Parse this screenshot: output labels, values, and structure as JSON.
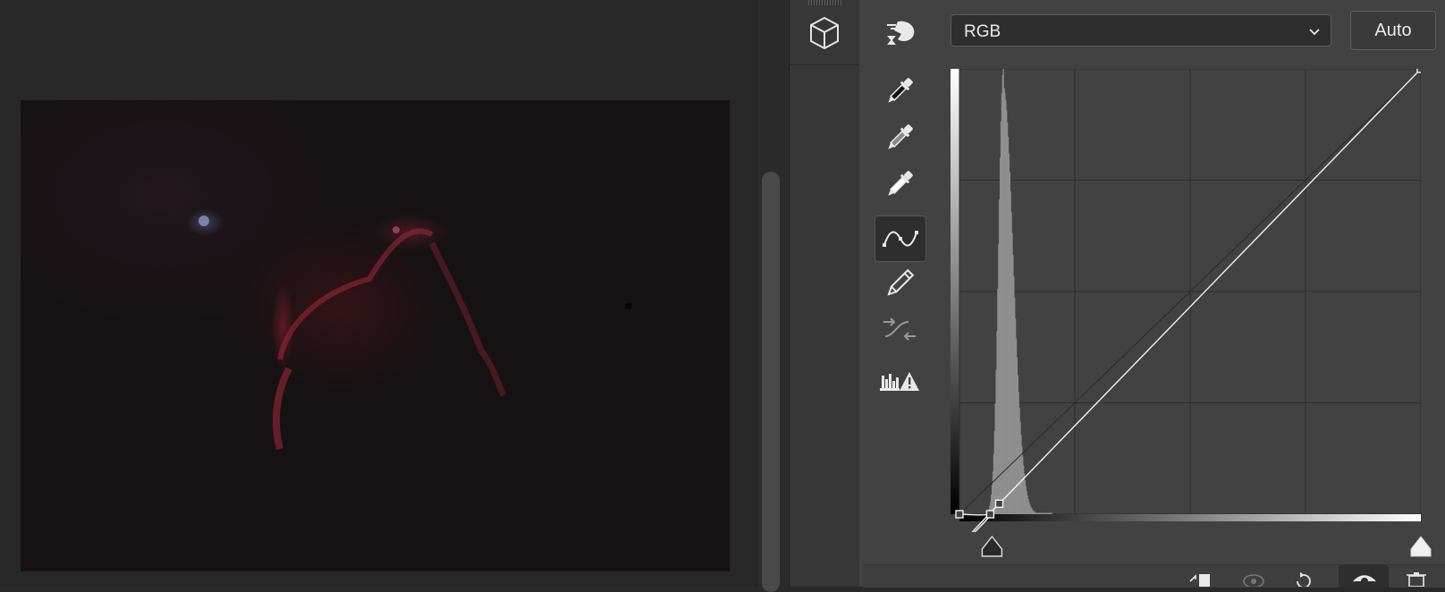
{
  "canvas": {
    "photo_name": "astro-photo"
  },
  "curves": {
    "channel_select": {
      "value": "RGB"
    },
    "auto_label": "Auto",
    "curve_points": [
      [
        0,
        0
      ],
      [
        17,
        0
      ],
      [
        22,
        6
      ],
      [
        255,
        255
      ]
    ]
  },
  "toolbar": {
    "tools": [
      {
        "name": "on-image-adjust-icon",
        "active": false
      },
      {
        "name": "black-point-eyedropper-icon",
        "active": false
      },
      {
        "name": "gray-point-eyedropper-icon",
        "active": false
      },
      {
        "name": "white-point-eyedropper-icon",
        "active": false
      },
      {
        "name": "curve-points-icon",
        "active": true
      },
      {
        "name": "pencil-draw-icon",
        "active": false
      },
      {
        "name": "smooth-curve-icon",
        "active": false
      },
      {
        "name": "clipping-warning-icon",
        "active": false
      }
    ]
  },
  "bottom_icons": [
    "clip-to-layer-icon",
    "view-previous-icon",
    "reset-icon",
    "toggle-visibility-icon",
    "delete-icon"
  ]
}
